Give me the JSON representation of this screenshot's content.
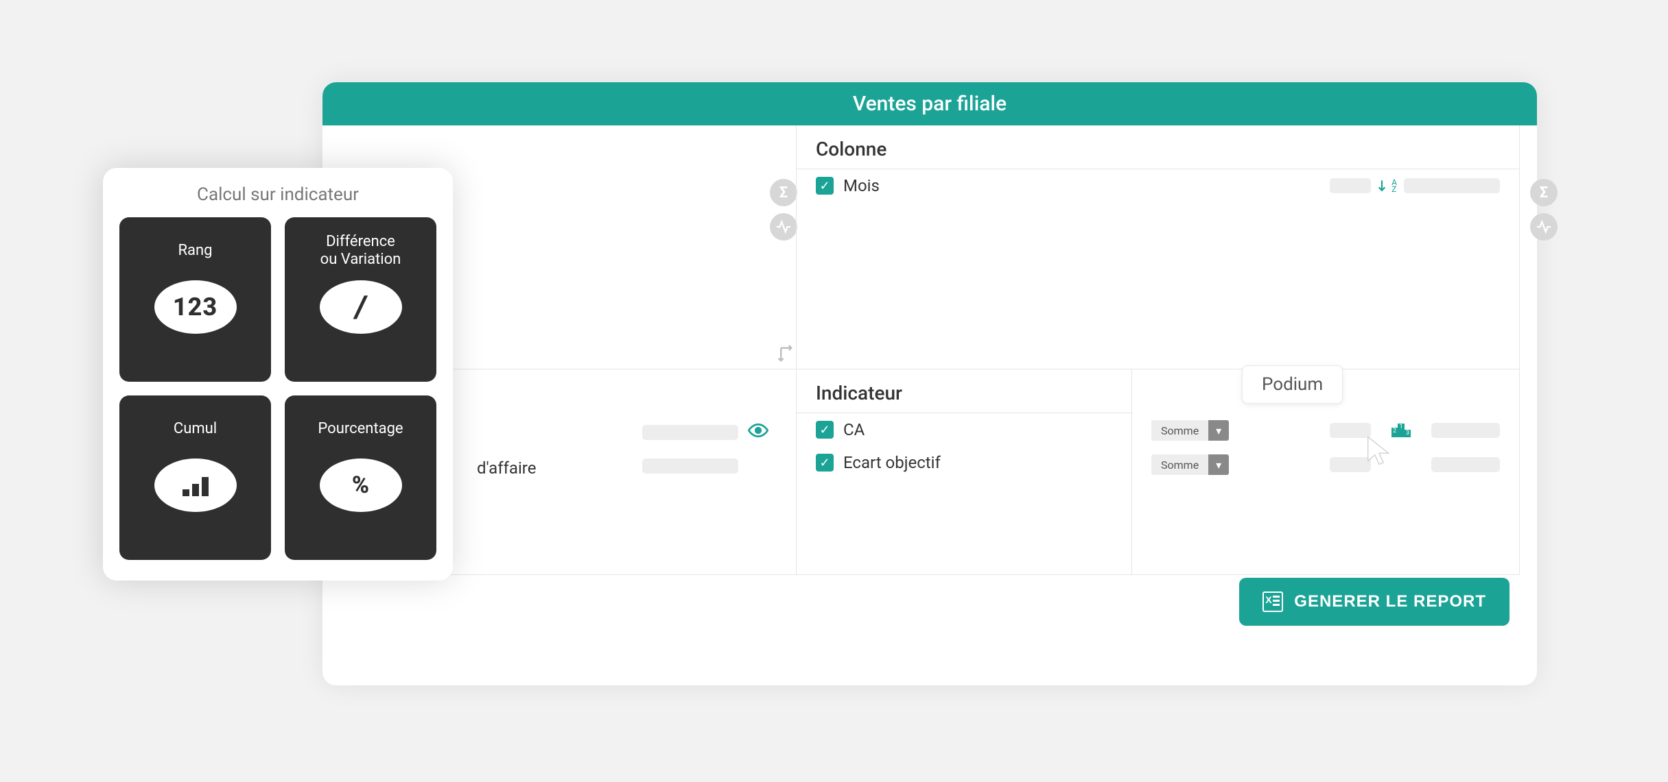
{
  "window": {
    "title": "Ventes par filiale"
  },
  "colonne": {
    "heading": "Colonne",
    "items": [
      {
        "label": "Mois"
      }
    ]
  },
  "ligne": {
    "peek_label": "d'affaire"
  },
  "indicateur": {
    "heading": "Indicateur",
    "items": [
      {
        "label": "CA",
        "agg": "Somme"
      },
      {
        "label": "Ecart objectif",
        "agg": "Somme"
      }
    ]
  },
  "options": {
    "tooltip": "Podium"
  },
  "generate": {
    "label": "GENERER LE REPORT"
  },
  "calc_panel": {
    "title": "Calcul sur indicateur",
    "tiles": [
      {
        "label": "Rang",
        "symbol": "123"
      },
      {
        "label": "Différence\nou Variation",
        "symbol": "/"
      },
      {
        "label": "Cumul",
        "symbol": ""
      },
      {
        "label": "Pourcentage",
        "symbol": "%"
      }
    ]
  }
}
